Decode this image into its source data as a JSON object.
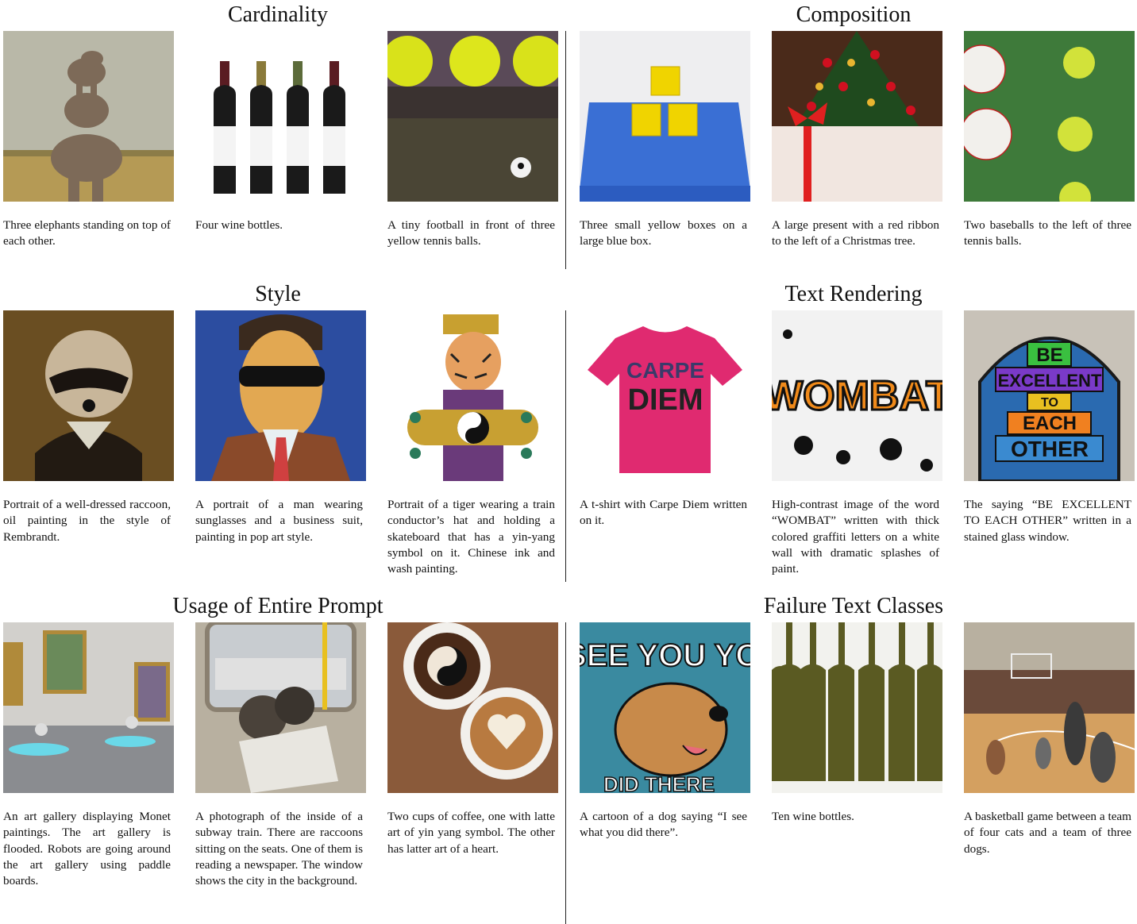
{
  "sections": {
    "cardinality": {
      "title": "Cardinality",
      "captions": [
        "Three elephants standing on top of each other.",
        "Four wine bottles.",
        "A tiny football in front of three yellow tennis balls."
      ]
    },
    "composition": {
      "title": "Composition",
      "captions": [
        "Three small yellow boxes on a large blue box.",
        "A large present with a red rib­bon to the left of a Christmas tree.",
        "Two baseballs to the left of three tennis balls."
      ]
    },
    "style": {
      "title": "Style",
      "captions": [
        "Portrait of a well-dressed rac­coon, oil painting in the style of Rembrandt.",
        "A portrait of a man wearing sunglasses and a business suit, painting in pop art style.",
        "Portrait of a tiger wearing a train conductor’s hat and holding a skateboard that has a yin-yang symbol on it. Chi­nese ink and wash painting."
      ]
    },
    "text_rendering": {
      "title": "Text Rendering",
      "captions": [
        "A t-shirt with Carpe Diem written on it.",
        "High-contrast image of the word “WOMBAT” written with thick colored graffiti let­ters on a white wall with dra­matic splashes of paint.",
        "The saying “BE EXCEL­LENT TO EACH OTHER” written in a stained glass win­dow."
      ]
    },
    "usage": {
      "title": "Usage of Entire Prompt",
      "captions": [
        "An art gallery displaying Monet paintings. The art gallery is flooded. Robots are going around the art gallery using paddle boards.",
        "A photograph of the inside of a subway train. There are raccoons sitting on the seats. One of them is read­ing a newspaper. The window shows the city in the back­ground.",
        "Two cups of coffee, one with latte art of yin yang symbol. The other has latter art of a heart."
      ]
    },
    "failure": {
      "title": "Failure Text Classes",
      "captions": [
        "A cartoon of a dog saying “I see what you did there”.",
        "Ten wine bottles.",
        "A basketball game between a team of four cats and a team of three dogs."
      ]
    }
  },
  "image_text": {
    "tshirt": [
      "CARPE",
      "DIEM"
    ],
    "graffiti": "WOMBAT",
    "stained_glass": [
      "BE",
      "EXCELLENT",
      "TO",
      "EACH",
      "OTHER"
    ],
    "cartoon_top": "I SEE YOU YOU",
    "cartoon_bottom": "DID THERE"
  }
}
